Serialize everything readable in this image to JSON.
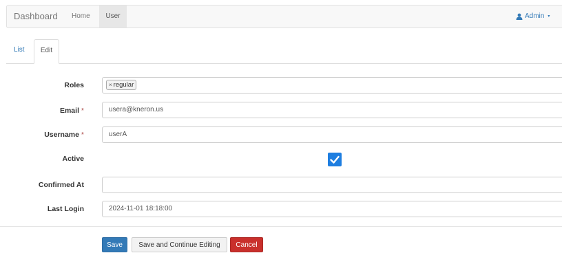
{
  "navbar": {
    "brand": "Dashboard",
    "items": [
      {
        "label": "Home",
        "active": false
      },
      {
        "label": "User",
        "active": true
      }
    ],
    "user_menu": {
      "label": "Admin",
      "icon": "user-icon",
      "caret": "▾"
    }
  },
  "tabs": [
    {
      "label": "List",
      "active": false
    },
    {
      "label": "Edit",
      "active": true
    }
  ],
  "form": {
    "roles": {
      "label": "Roles",
      "tags": [
        "regular"
      ],
      "remove_glyph": "×"
    },
    "email": {
      "label": "Email",
      "required_mark": "*",
      "value": "usera@kneron.us"
    },
    "username": {
      "label": "Username",
      "required_mark": "*",
      "value": "userA"
    },
    "active": {
      "label": "Active",
      "checked": true
    },
    "confirmed_at": {
      "label": "Confirmed At",
      "value": ""
    },
    "last_login": {
      "label": "Last Login",
      "value": "2024-11-01 18:18:00"
    }
  },
  "actions": {
    "save": "Save",
    "save_continue": "Save and Continue Editing",
    "cancel": "Cancel"
  },
  "colors": {
    "primary": "#337ab7",
    "danger": "#c9302c",
    "checkbox": "#1e7ee0",
    "required": "#a94442"
  }
}
